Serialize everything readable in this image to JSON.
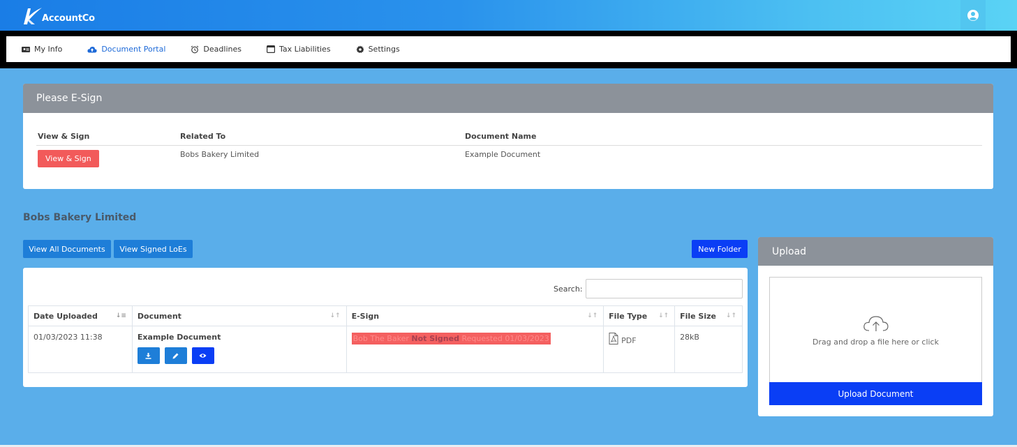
{
  "brand": {
    "name": "AccountCo"
  },
  "nav": {
    "items": [
      {
        "label": "My Info",
        "icon": "id-card-icon",
        "active": false
      },
      {
        "label": "Document Portal",
        "icon": "cloud-upload-icon",
        "active": true
      },
      {
        "label": "Deadlines",
        "icon": "alarm-clock-icon",
        "active": false
      },
      {
        "label": "Tax Liabilities",
        "icon": "window-icon",
        "active": false
      },
      {
        "label": "Settings",
        "icon": "gear-icon",
        "active": false
      }
    ]
  },
  "esign": {
    "title": "Please E-Sign",
    "headers": {
      "view_sign": "View & Sign",
      "related_to": "Related To",
      "document_name": "Document Name"
    },
    "row": {
      "button": "View & Sign",
      "related_to": "Bobs Bakery Limited",
      "document_name": "Example Document"
    }
  },
  "company": {
    "title": "Bobs Bakery Limited",
    "buttons": {
      "view_all": "View All Documents",
      "view_signed": "View Signed LoEs",
      "new_folder": "New Folder"
    }
  },
  "documents": {
    "search_label": "Search:",
    "search_value": "",
    "headers": [
      "Date Uploaded",
      "Document",
      "E-Sign",
      "File Type",
      "File Size"
    ],
    "rows": [
      {
        "date_uploaded": "01/03/2023 11:38",
        "document": "Example Document",
        "esign_name": "Bob The Baker",
        "esign_status": "Not Signed",
        "esign_requested": "Requested 01/03/2023",
        "file_type": "PDF",
        "file_size": "28kB"
      }
    ]
  },
  "upload": {
    "title": "Upload",
    "dropzone_text": "Drag and drop a file here or click",
    "button": "Upload Document"
  },
  "colors": {
    "primary": "#1e7ed8",
    "deep_blue": "#0a3ef5",
    "danger": "#f25a5a",
    "panel_header": "#8c929a",
    "background": "#5aaeea"
  }
}
